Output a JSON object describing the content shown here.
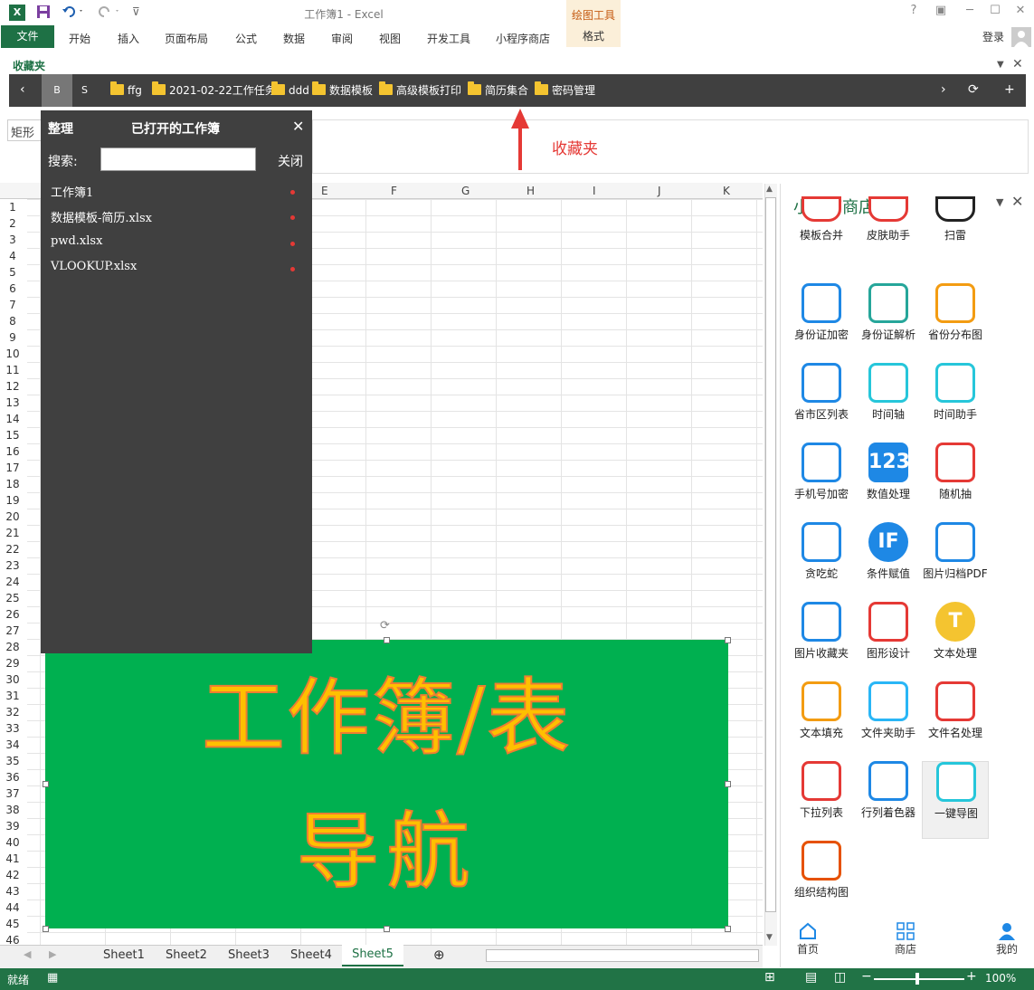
{
  "window": {
    "title": "工作簿1 - Excel",
    "drawing_tools": "绘图工具",
    "help": "?",
    "minimize": "─",
    "restore": "☐",
    "close": "✕"
  },
  "ribbon": {
    "file": "文件",
    "tabs": [
      "开始",
      "插入",
      "页面布局",
      "公式",
      "数据",
      "审阅",
      "视图",
      "开发工具",
      "小程序商店"
    ],
    "format": "格式",
    "login": "登录"
  },
  "favorites": {
    "label": "收藏夹",
    "btn_b": "B",
    "btn_s": "S",
    "folders": [
      "ffg",
      "2021-02-22工作任务",
      "ddd",
      "数据模板",
      "高级模板打印",
      "简历集合",
      "密码管理"
    ]
  },
  "namebox": "矩形",
  "annotation": "收藏夹",
  "columns": [
    "E",
    "F",
    "G",
    "H",
    "I",
    "J",
    "K"
  ],
  "rows": [
    "1",
    "2",
    "3",
    "4",
    "5",
    "6",
    "7",
    "8",
    "9",
    "10",
    "11",
    "12",
    "13",
    "14",
    "15",
    "16",
    "17",
    "18",
    "19",
    "20",
    "21",
    "22",
    "23",
    "24",
    "25",
    "26",
    "27",
    "28",
    "29",
    "30",
    "31",
    "32",
    "33",
    "34",
    "35",
    "36",
    "37",
    "38",
    "39",
    "40",
    "41",
    "42",
    "43",
    "44",
    "45",
    "46"
  ],
  "workbook_panel": {
    "organize": "整理",
    "title": "已打开的工作簿",
    "close_icon": "✕",
    "search_label": "搜索:",
    "close_label": "关闭",
    "items": [
      "工作簿1",
      "数据模板-简历.xlsx",
      "pwd.xlsx",
      "VLOOKUP.xlsx"
    ]
  },
  "shape": {
    "line1": "工作簿/表",
    "line2": "导航",
    "fill": "#00b050",
    "text_color": "#ffc000"
  },
  "sheets": [
    "Sheet1",
    "Sheet2",
    "Sheet3",
    "Sheet4",
    "Sheet5"
  ],
  "active_sheet": "Sheet5",
  "status": {
    "ready": "就绪",
    "zoom": "100%"
  },
  "store": {
    "title": "小程序商店",
    "apps": [
      {
        "label": "模板合并",
        "icon": "merge-icon",
        "color": "#e53935"
      },
      {
        "label": "皮肤助手",
        "icon": "skin-icon",
        "color": "#e53935"
      },
      {
        "label": "扫雷",
        "icon": "mine-icon",
        "color": "#222222"
      },
      {
        "label": "身份证加密",
        "icon": "id-card-icon",
        "color": "#1e88e5"
      },
      {
        "label": "身份证解析",
        "icon": "id-card-icon",
        "color": "#26a69a"
      },
      {
        "label": "省份分布图",
        "icon": "china-map-icon",
        "color": "#f39c12"
      },
      {
        "label": "省市区列表",
        "icon": "location-icon",
        "color": "#1e88e5"
      },
      {
        "label": "时间轴",
        "icon": "timeline-icon",
        "color": "#26c6da"
      },
      {
        "label": "时间助手",
        "icon": "clock-icon",
        "color": "#26c6da"
      },
      {
        "label": "手机号加密",
        "icon": "phone-icon",
        "color": "#1e88e5"
      },
      {
        "label": "数值处理",
        "icon": "number-icon",
        "color": "#1e88e5",
        "text": "123"
      },
      {
        "label": "随机抽",
        "icon": "wheel-icon",
        "color": "#e53935"
      },
      {
        "label": "贪吃蛇",
        "icon": "ghost-icon",
        "color": "#1e88e5"
      },
      {
        "label": "条件赋值",
        "icon": "if-icon",
        "color": "#1e88e5",
        "text": "IF"
      },
      {
        "label": "图片归档PDF",
        "icon": "folder-upload-icon",
        "color": "#1e88e5"
      },
      {
        "label": "图片收藏夹",
        "icon": "image-icon",
        "color": "#1e88e5"
      },
      {
        "label": "图形设计",
        "icon": "shapes-icon",
        "color": "#e53935"
      },
      {
        "label": "文本处理",
        "icon": "text-icon",
        "color": "#f4c430",
        "text": "T"
      },
      {
        "label": "文本填充",
        "icon": "document-icon",
        "color": "#f39c12"
      },
      {
        "label": "文件夹助手",
        "icon": "folder-icon",
        "color": "#29b6f6"
      },
      {
        "label": "文件名处理",
        "icon": "files-icon",
        "color": "#e53935"
      },
      {
        "label": "下拉列表",
        "icon": "dropdown-icon",
        "color": "#e53935"
      },
      {
        "label": "行列着色器",
        "icon": "paint-bucket-icon",
        "color": "#1e88e5"
      },
      {
        "label": "一键导图",
        "icon": "image-export-icon",
        "color": "#26c6da"
      },
      {
        "label": "组织结构图",
        "icon": "org-chart-icon",
        "color": "#e65100"
      }
    ],
    "nav": [
      "首页",
      "商店",
      "我的"
    ]
  }
}
